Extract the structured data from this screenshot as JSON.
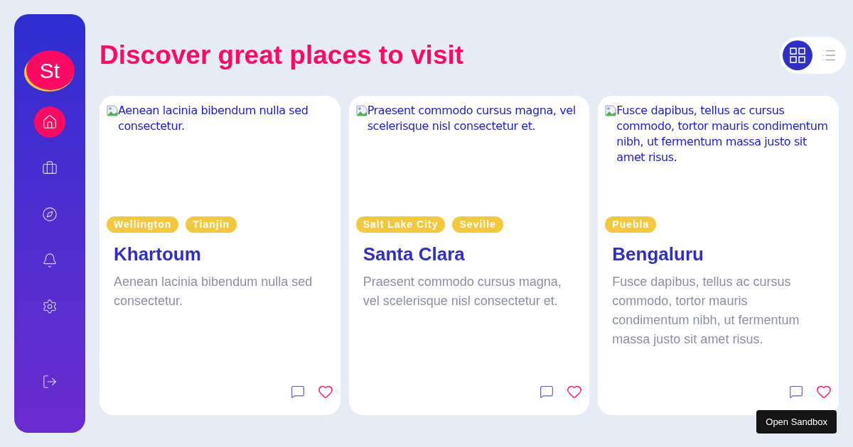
{
  "sidebar": {
    "logo": "St",
    "nav_items": [
      {
        "selected": true
      },
      {
        "selected": false
      },
      {
        "selected": false
      },
      {
        "selected": false
      },
      {
        "selected": false
      }
    ]
  },
  "header": {
    "title": "Discover great places to visit",
    "view_toggle": [
      {
        "selected": true
      },
      {
        "selected": false
      }
    ]
  },
  "cards": [
    {
      "image_alt": "Aenean lacinia bibendum nulla sed consectetur.",
      "tags": [
        "Wellington",
        "Tianjin"
      ],
      "title": "Khartoum",
      "description": "Aenean lacinia bibendum nulla sed consectetur."
    },
    {
      "image_alt": "Praesent commodo cursus magna, vel scelerisque nisl consectetur et.",
      "tags": [
        "Salt Lake City",
        "Seville"
      ],
      "title": "Santa Clara",
      "description": "Praesent commodo cursus magna, vel scelerisque nisl consectetur et."
    },
    {
      "image_alt": "Fusce dapibus, tellus ac cursus commodo, tortor mauris condimentum nibh, ut fermentum massa justo sit amet risus.",
      "tags": [
        "Puebla"
      ],
      "title": "Bengaluru",
      "description": "Fusce dapibus, tellus ac cursus commodo, tortor mauris condimentum nibh, ut fermentum massa justo sit amet risus."
    }
  ],
  "open_sandbox_button": "Open Sandbox"
}
